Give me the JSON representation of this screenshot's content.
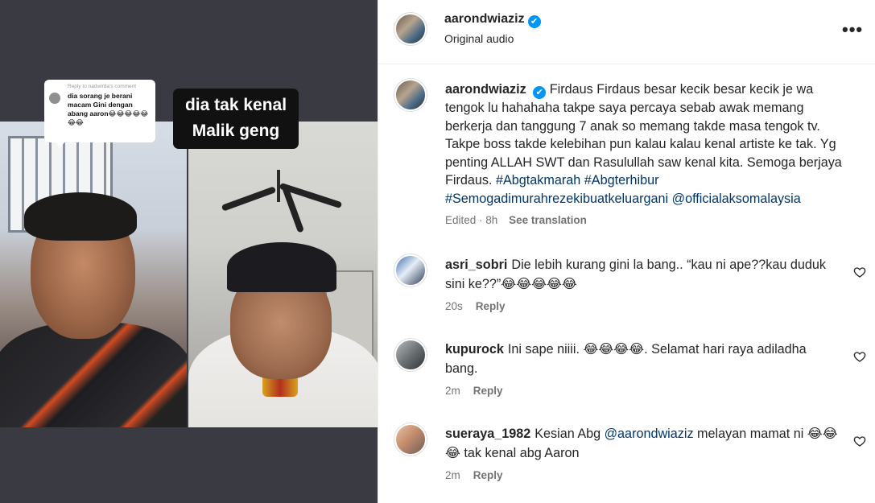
{
  "media": {
    "reply_header": "Reply to nadwirda's comment",
    "reply_text": "dia sorang je berani macam Gini dengan abang aaron😂😂😂😂😂😂😂",
    "overlay_caption_line1": "dia tak kenal",
    "overlay_caption_line2": "Malik geng"
  },
  "header": {
    "username": "aarondwiaziz",
    "verified_icon": "✔",
    "subtitle": "Original audio",
    "more_icon": "•••"
  },
  "caption": {
    "username": "aarondwiaziz",
    "text": "Firdaus Firdaus besar kecik besar kecik je wa tengok lu hahahaha takpe saya percaya sebab awak memang berkerja dan tanggung 7 anak so memang takde masa tengok tv. Takpe boss takde kelebihan pun kalau kalau kenal artiste ke tak. Yg penting ALLAH SWT dan Rasulullah saw kenal kita. Semoga berjaya Firdaus. ",
    "hashtags": [
      "#Abgtakmarah",
      "#Abgterhibur",
      "#Semogadimurahrezekibuatkeluargani",
      "@officialaksomalaysia"
    ],
    "time": "Edited · 8h",
    "see_translation": "See translation"
  },
  "comments": [
    {
      "username": "asri_sobri",
      "text": "Die lebih kurang gini la bang.. “kau ni ape??kau duduk sini ke??”😂😂😂😂😂",
      "time": "20s",
      "reply_label": "Reply"
    },
    {
      "username": "kupurock",
      "text": "Ini sape niiii. 😂😂😂😂. Selamat hari raya adiladha bang.",
      "time": "2m",
      "reply_label": "Reply"
    },
    {
      "username": "sueraya_1982",
      "text_before": "Kesian Abg ",
      "mention": "@aarondwiaziz",
      "text_after": " melayan mamat ni 😂😂😂 tak kenal abg Aaron",
      "time": "2m",
      "reply_label": "Reply"
    }
  ],
  "colors": {
    "link": "#00376b",
    "verified": "#0095f6",
    "muted": "#737373",
    "media_bg": "#3a3b42"
  }
}
